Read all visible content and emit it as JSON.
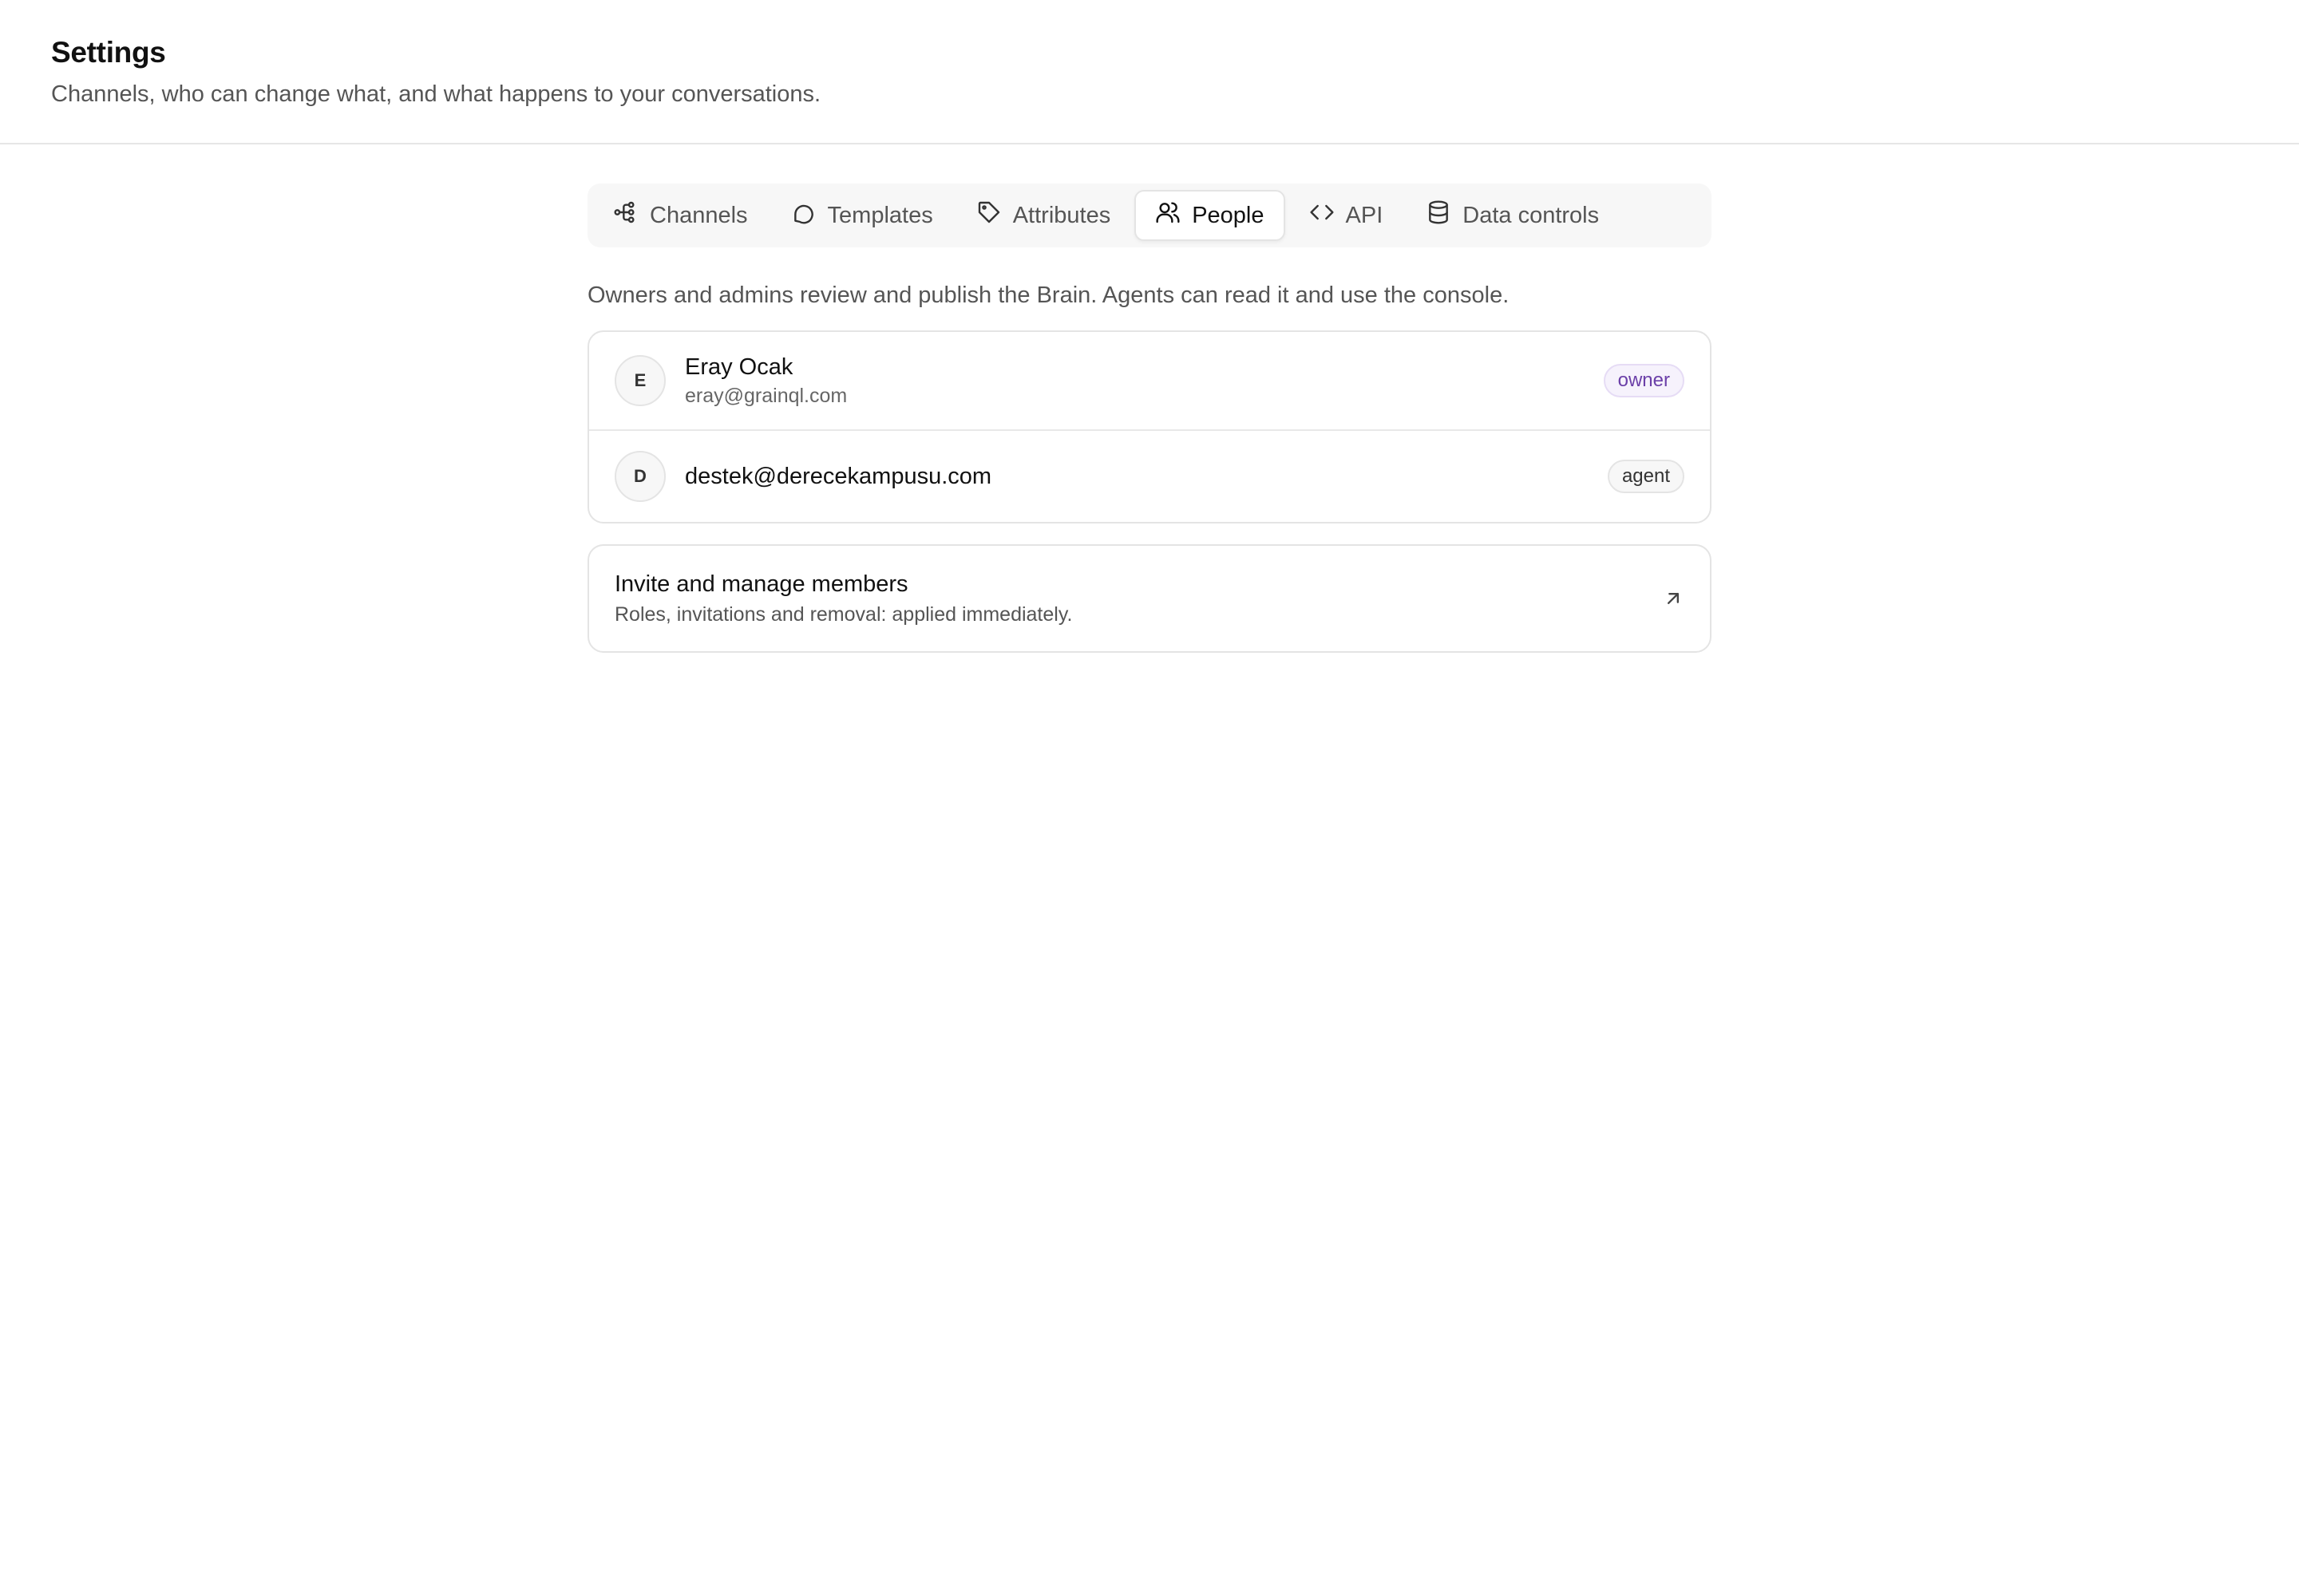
{
  "header": {
    "title": "Settings",
    "subtitle": "Channels, who can change what, and what happens to your conversations."
  },
  "tabs": [
    {
      "label": "Channels",
      "icon": "channels-icon",
      "active": false
    },
    {
      "label": "Templates",
      "icon": "chat-bubble-icon",
      "active": false
    },
    {
      "label": "Attributes",
      "icon": "tag-icon",
      "active": false
    },
    {
      "label": "People",
      "icon": "users-icon",
      "active": true
    },
    {
      "label": "API",
      "icon": "code-icon",
      "active": false
    },
    {
      "label": "Data controls",
      "icon": "database-icon",
      "active": false
    }
  ],
  "people": {
    "intro": "Owners and admins review and publish the Brain. Agents can read it and use the console.",
    "members": [
      {
        "initial": "E",
        "name": "Eray Ocak",
        "email": "eray@grainql.com",
        "role": "owner"
      },
      {
        "initial": "D",
        "name": "destek@derecekampusu.com",
        "role": "agent"
      }
    ],
    "manage": {
      "title": "Invite and manage members",
      "description": "Roles, invitations and removal: applied immediately.",
      "icon": "arrow-up-right-icon"
    }
  },
  "colors": {
    "owner_badge_text": "#6b3fa8",
    "owner_badge_bg": "#f6f2fc",
    "border": "#e4e4e4"
  }
}
